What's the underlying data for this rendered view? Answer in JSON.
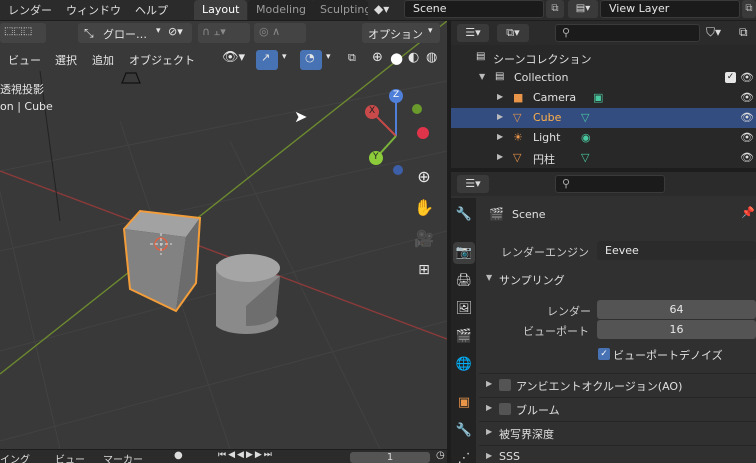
{
  "menubar": {
    "items": [
      "レンダー",
      "ウィンドウ",
      "ヘルプ"
    ],
    "workspace_tabs": [
      "Layout",
      "Modeling",
      "Sculpting"
    ],
    "scene_name": "Scene",
    "view_layer": "View Layer"
  },
  "viewport": {
    "header": {
      "transform_orientation": "グロー…",
      "options_label": "オプション"
    },
    "menu": [
      "ビュー",
      "選択",
      "追加",
      "オブジェクト"
    ],
    "overlay_text": {
      "projection": "透視投影",
      "context": "on | Cube"
    },
    "gizmo": {
      "x_label": "X",
      "y_label": "Y",
      "z_label": "Z"
    }
  },
  "timeline": {
    "items": [
      "イング",
      "ビュー",
      "マーカー"
    ],
    "frame": "1"
  },
  "outliner": {
    "scene_collection": "シーンコレクション",
    "collection": "Collection",
    "objects": [
      {
        "label": "Camera",
        "selected": false
      },
      {
        "label": "Cube",
        "selected": true
      },
      {
        "label": "Light",
        "selected": false
      },
      {
        "label": "円柱",
        "selected": false
      }
    ]
  },
  "properties": {
    "scene_label": "Scene",
    "render_engine_label": "レンダーエンジン",
    "render_engine_value": "Eevee",
    "sampling": {
      "title": "サンプリング",
      "render_label": "レンダー",
      "render_value": "64",
      "viewport_label": "ビューポート",
      "viewport_value": "16",
      "denoise_label": "ビューポートデノイズ",
      "denoise_checked": true
    },
    "panels": [
      {
        "label": "アンビエントオクルージョン(AO)",
        "has_checkbox": true
      },
      {
        "label": "ブルーム",
        "has_checkbox": true
      },
      {
        "label": "被写界深度",
        "has_checkbox": false
      },
      {
        "label": "SSS",
        "has_checkbox": false
      }
    ]
  }
}
